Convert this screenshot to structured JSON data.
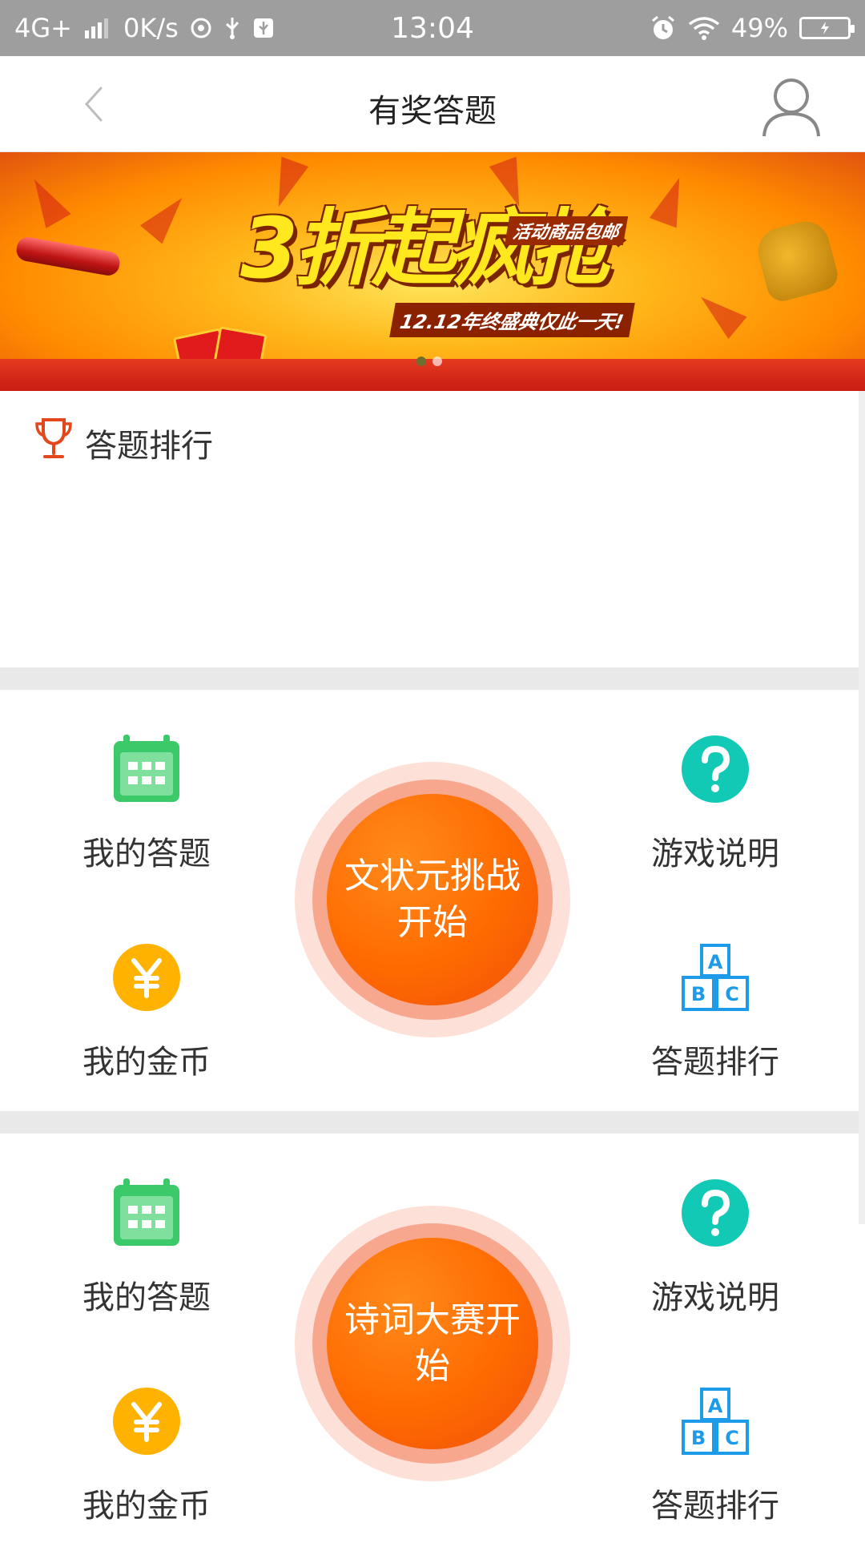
{
  "status_bar": {
    "network": "4G+",
    "speed": "0K/s",
    "time": "13:04",
    "battery": "49%"
  },
  "header": {
    "title": "有奖答题"
  },
  "banner": {
    "headline": "3折起疯抢",
    "tag": "活动商品包邮",
    "subline": "12.12年终盛典仅此一天!",
    "slides_total": 2,
    "slide_active": 1
  },
  "ranking": {
    "title": "答题排行"
  },
  "panels": [
    {
      "start_label": "文状元挑战开始",
      "left_top": "我的答题",
      "left_bottom": "我的金币",
      "right_top": "游戏说明",
      "right_bottom": "答题排行"
    },
    {
      "start_label": "诗词大赛开始",
      "left_top": "我的答题",
      "left_bottom": "我的金币",
      "right_top": "游戏说明",
      "right_bottom": "答题排行"
    }
  ],
  "icons": {
    "back": "chevron-left-icon",
    "user": "user-icon",
    "trophy": "trophy-icon",
    "calendar": "calendar-icon",
    "coin": "yuan-coin-icon",
    "help": "question-icon",
    "blocks": "abc-blocks-icon"
  },
  "colors": {
    "status_bar": "#9e9e9e",
    "accent_orange": "#ff6a00",
    "calendar_green": "#3cc96a",
    "coin_yellow": "#ffb300",
    "help_teal": "#11c9b4",
    "blocks_blue": "#1e9be8",
    "trophy_red": "#e4471c"
  }
}
